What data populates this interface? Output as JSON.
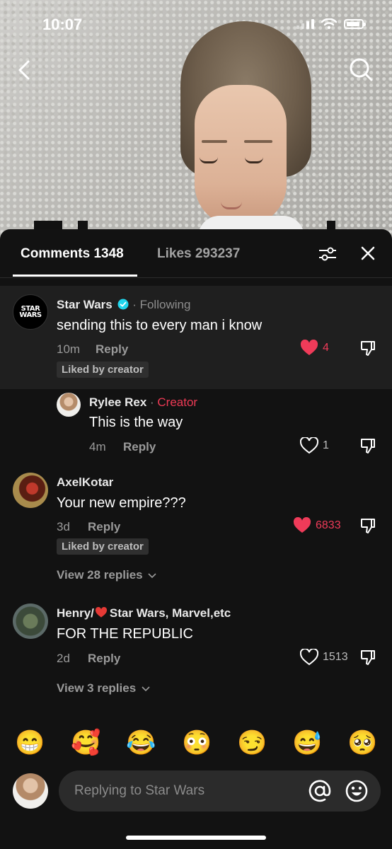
{
  "status_bar": {
    "time": "10:07"
  },
  "sheet": {
    "tabs": {
      "comments_label": "Comments 1348",
      "likes_label": "Likes 293237"
    }
  },
  "comments": [
    {
      "username": "Star Wars",
      "verified": true,
      "following_label": "Following",
      "text": "sending this to every man i know",
      "time": "10m",
      "reply_label": "Reply",
      "liked_by_creator": "Liked by creator",
      "likes": "4",
      "liked": true,
      "avatar_text": "STAR WARS"
    },
    {
      "username": "Rylee Rex",
      "creator_label": "Creator",
      "text": "This is the way",
      "time": "4m",
      "reply_label": "Reply",
      "likes": "1",
      "liked": false
    },
    {
      "username": "AxelKotar",
      "text": "Your new empire???",
      "time": "3d",
      "reply_label": "Reply",
      "liked_by_creator": "Liked by creator",
      "likes": "6833",
      "liked": true,
      "view_replies": "View 28 replies"
    },
    {
      "username_prefix": "Henry/",
      "username_suffix": "Star Wars, Marvel,etc",
      "text": "FOR THE REPUBLIC",
      "time": "2d",
      "reply_label": "Reply",
      "likes": "1513",
      "liked": false,
      "view_replies": "View 3 replies"
    }
  ],
  "emoji_bar": [
    "😁",
    "🥰",
    "😂",
    "😳",
    "😏",
    "😅",
    "🥺"
  ],
  "input": {
    "placeholder": "Replying to Star Wars"
  },
  "colors": {
    "like_red": "#ef3b59",
    "creator_red": "#ee3a55",
    "verified_blue": "#20d5ec"
  }
}
